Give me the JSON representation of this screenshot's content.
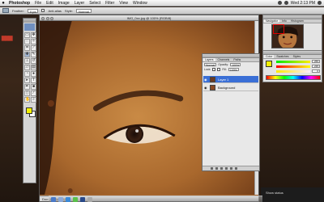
{
  "menubar": {
    "app_name": "Photoshop",
    "items": [
      "File",
      "Edit",
      "Image",
      "Layer",
      "Select",
      "Filter",
      "View",
      "Window"
    ],
    "clock": "Wed 2:13 PM",
    "colors": {
      "bar": "#e8e8e8"
    }
  },
  "options": {
    "feather_label": "Feather:",
    "feather_value": "0 px",
    "antialias_label": "Anti-alias",
    "style_label": "Style:",
    "style_value": "Normal"
  },
  "document": {
    "title": "IMG_0xx.jpg @ 100% (RGB/8)",
    "status": "Doc: 1.22M/1.22M"
  },
  "navigator": {
    "tabs": [
      "Navigator",
      "Info",
      "Histogram"
    ]
  },
  "color": {
    "tabs": [
      "Color",
      "Swatches",
      "Styles"
    ],
    "r": "255",
    "g": "235",
    "b": "0",
    "fg_color": "#f2ef00"
  },
  "layers": {
    "tabs": [
      "Layers",
      "Channels",
      "Paths"
    ],
    "blend_mode": "Normal",
    "opacity_label": "Opacity:",
    "opacity_value": "100%",
    "lock_label": "Lock:",
    "fill_label": "Fill:",
    "fill_value": "100%",
    "items": [
      {
        "name": "Layer 1",
        "selected": true
      },
      {
        "name": "Background",
        "selected": false
      }
    ]
  },
  "dock": {
    "icons": [
      "finder-icon",
      "mail-icon",
      "safari-icon",
      "itunes-icon",
      "photoshop-icon",
      "trash-icon"
    ]
  },
  "status_panel": {
    "items": [
      "Show status"
    ]
  }
}
